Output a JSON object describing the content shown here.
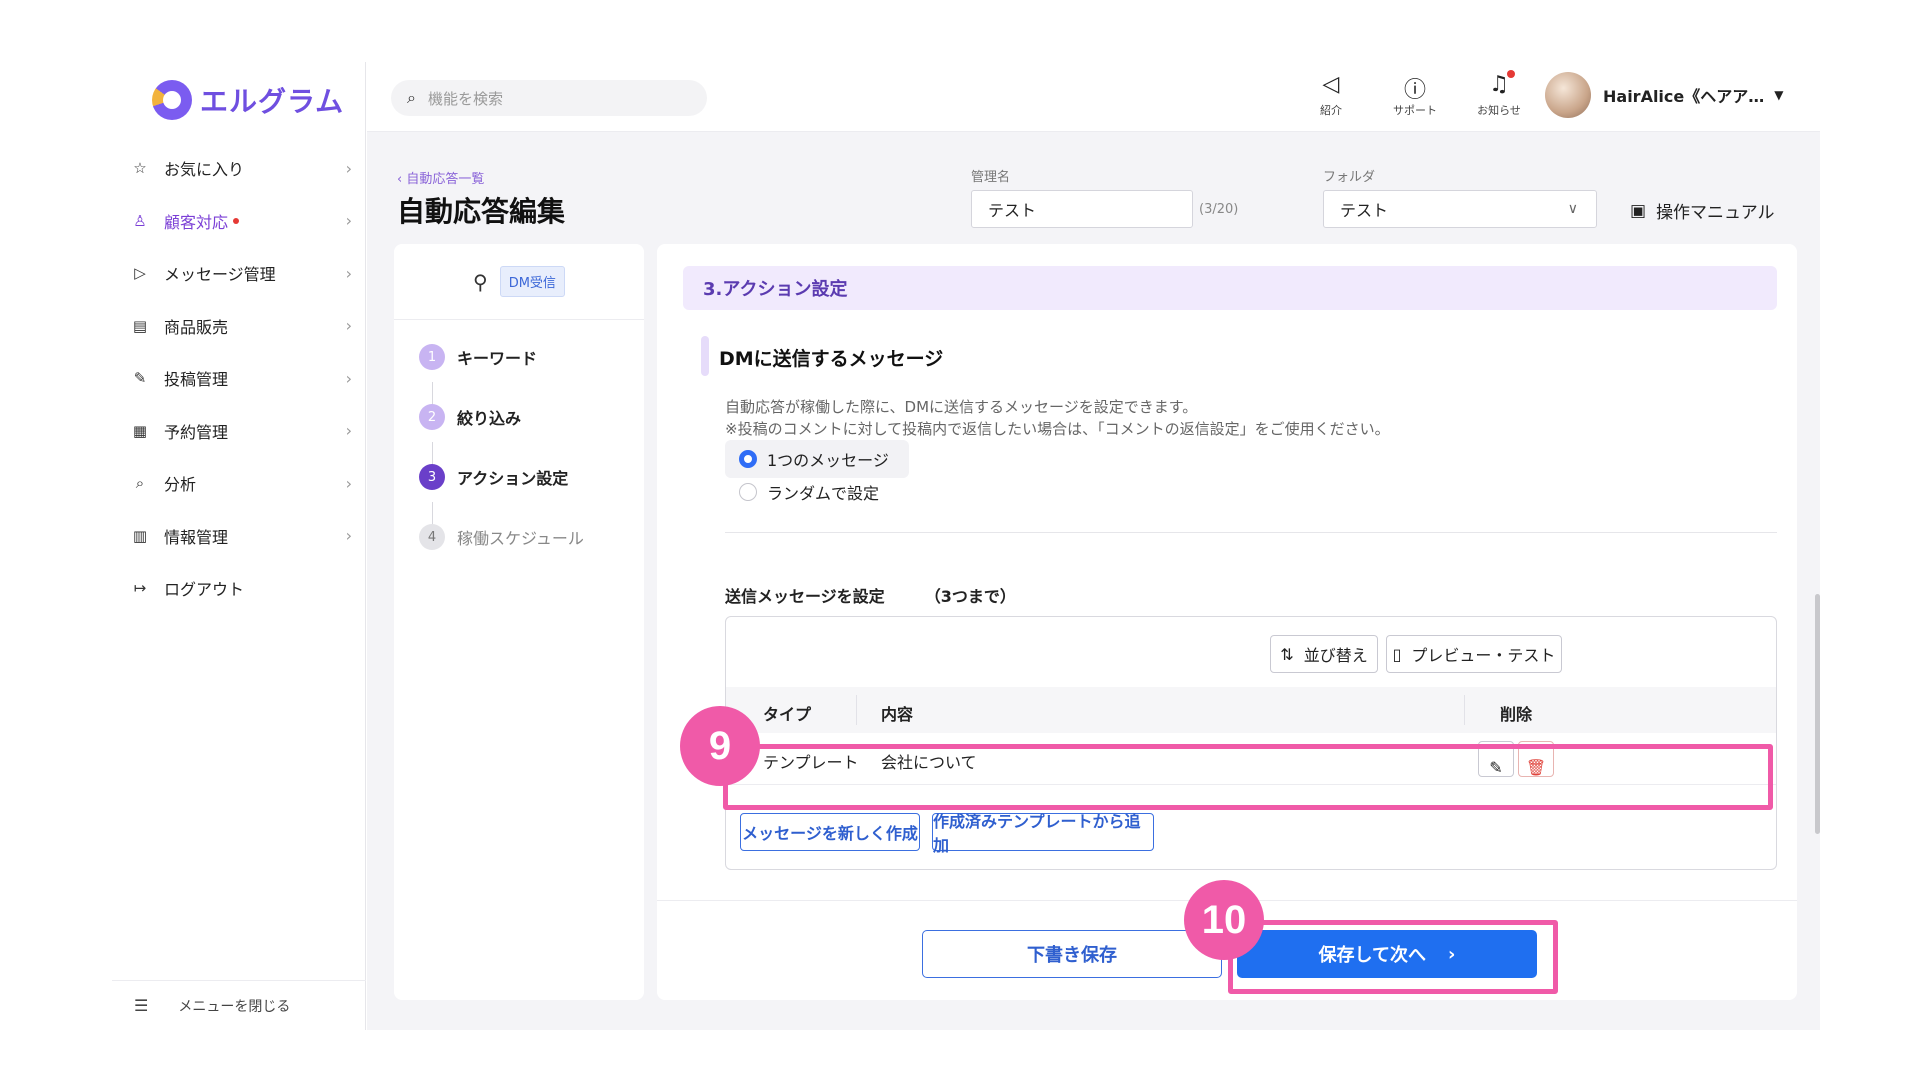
{
  "app": {
    "logo_text": "エルグラム"
  },
  "sidebar": {
    "items": [
      {
        "label": "お気に入り",
        "icon": "star-icon"
      },
      {
        "label": "顧客対応",
        "icon": "user-icon",
        "active": true,
        "dot": true
      },
      {
        "label": "メッセージ管理",
        "icon": "send-icon"
      },
      {
        "label": "商品販売",
        "icon": "shop-icon"
      },
      {
        "label": "投稿管理",
        "icon": "edit-icon"
      },
      {
        "label": "予約管理",
        "icon": "calendar-icon"
      },
      {
        "label": "分析",
        "icon": "analysis-icon"
      },
      {
        "label": "情報管理",
        "icon": "chart-icon"
      },
      {
        "label": "ログアウト",
        "icon": "logout-icon"
      }
    ],
    "close_menu": "メニューを閉じる"
  },
  "topbar": {
    "search_placeholder": "機能を検索",
    "icons": [
      {
        "label": "紹介",
        "icon": "megaphone-icon"
      },
      {
        "label": "サポート",
        "icon": "help-icon"
      },
      {
        "label": "お知らせ",
        "icon": "bell-icon"
      }
    ],
    "user_name": "HairAlice《ヘアア…"
  },
  "page": {
    "breadcrumb": "自動応答一覧",
    "title": "自動応答編集",
    "name_label": "管理名",
    "name_value": "テスト",
    "name_count": "(3/20)",
    "folder_label": "フォルダ",
    "folder_value": "テスト",
    "manual": "操作マニュアル"
  },
  "steps": {
    "trigger_tag": "DM受信",
    "items": [
      {
        "num": "1",
        "label": "キーワード",
        "state": "done"
      },
      {
        "num": "2",
        "label": "絞り込み",
        "state": "done"
      },
      {
        "num": "3",
        "label": "アクション設定",
        "state": "current"
      },
      {
        "num": "4",
        "label": "稼働スケジュール",
        "state": "future"
      }
    ]
  },
  "content": {
    "section_title": "3.アクション設定",
    "subsection_title": "DMに送信するメッセージ",
    "desc1": "自動応答が稼働した際に、DMに送信するメッセージを設定できます。",
    "desc2": "※投稿のコメントに対して投稿内で返信したい場合は、「コメントの返信設定」をご使用ください。",
    "radio_single": "1つのメッセージ",
    "radio_random": "ランダムで設定",
    "set_label": "送信メッセージを設定",
    "set_limit": "（3つまで）",
    "sort_button": "並び替え",
    "preview_button": "プレビュー・テスト",
    "table": {
      "headers": {
        "type": "タイプ",
        "content": "内容",
        "delete": "削除"
      },
      "rows": [
        {
          "type": "テンプレート",
          "content": "会社について"
        }
      ]
    },
    "new_message_button": "メッセージを新しく作成",
    "add_template_button": "作成済みテンプレートから追加",
    "draft_button": "下書き保存",
    "next_button": "保存して次へ"
  },
  "annotations": [
    {
      "label": "9"
    },
    {
      "label": "10"
    }
  ],
  "colors": {
    "accent": "#6f4fe0",
    "primary": "#1f6ff0",
    "highlight": "#f05aa8"
  }
}
